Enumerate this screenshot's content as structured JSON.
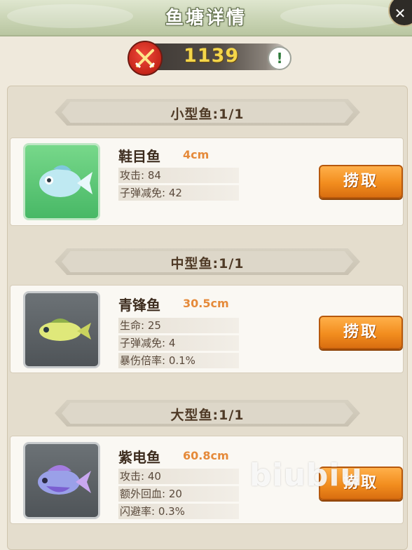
{
  "header": {
    "title": "鱼塘详情"
  },
  "power": {
    "value": "1139",
    "info_symbol": "!"
  },
  "sections": [
    {
      "label": "小型鱼:1/1",
      "fish": {
        "name": "鞋目鱼",
        "size": "4cm",
        "stats": [
          "攻击: 84",
          "子弹减免: 42"
        ],
        "action": "捞取",
        "rarity_color": "#5cc978"
      }
    },
    {
      "label": "中型鱼:1/1",
      "fish": {
        "name": "青锋鱼",
        "size": "30.5cm",
        "stats": [
          "生命: 25",
          "子弹减免: 4",
          "暴伤倍率: 0.1%"
        ],
        "action": "捞取",
        "rarity_color": "#5e6468"
      }
    },
    {
      "label": "大型鱼:1/1",
      "fish": {
        "name": "紫电鱼",
        "size": "60.8cm",
        "stats": [
          "攻击: 40",
          "额外回血: 20",
          "闪避率: 0.3%"
        ],
        "action": "捞取",
        "rarity_color": "#5e6468"
      }
    }
  ],
  "watermark": "biubiu"
}
